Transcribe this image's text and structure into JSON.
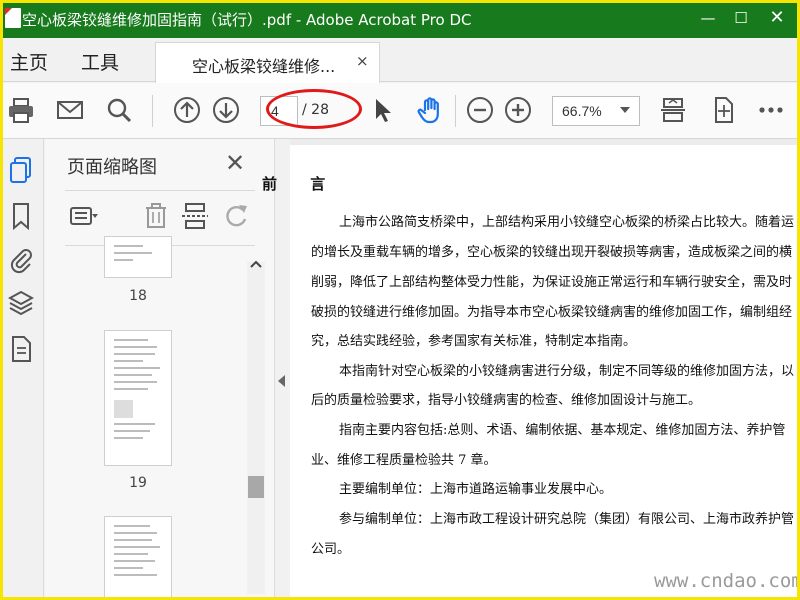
{
  "window": {
    "title": "空心板梁铰缝维修加固指南（试行）.pdf - Adobe Acrobat Pro DC",
    "minimize": "—",
    "maximize": "☐",
    "close": "✕"
  },
  "tabs": {
    "home": "主页",
    "tools": "工具",
    "document": "空心板梁铰缝维修...",
    "close": "×"
  },
  "toolbar": {
    "icons": [
      "printer-icon",
      "mail-icon",
      "search-icon",
      "page-up-icon",
      "page-down-icon",
      "select-arrow-icon",
      "hand-tool-icon",
      "zoom-out-icon",
      "zoom-in-icon",
      "fit-page-icon",
      "full-screen-icon",
      "more-icon"
    ],
    "current_page": "4",
    "total_pages": "/ 28",
    "zoom": "66.7%"
  },
  "left_rail": {
    "icons": [
      "page-thumbnails-icon",
      "bookmark-icon",
      "attachment-icon",
      "layers-icon",
      "document-icon"
    ]
  },
  "thumbnail_panel": {
    "title": "页面缩略图",
    "close": "✕",
    "tools": [
      "options-menu-icon",
      "delete-icon",
      "insert-page-icon",
      "rotate-icon"
    ],
    "pages": [
      {
        "number": "18"
      },
      {
        "number": "19"
      },
      {
        "number": ""
      }
    ]
  },
  "document": {
    "heading": "前 言",
    "lines": [
      "上海市公路简支桥梁中，上部结构采用小铰缝空心板梁的桥梁占比较大。随着运",
      "的增长及重载车辆的增多，空心板梁的铰缝出现开裂破损等病害，造成板梁之间的横",
      "削弱，降低了上部结构整体受力性能，为保证设施正常运行和车辆行驶安全，需及时",
      "破损的铰缝进行维修加固。为指导本市空心板梁铰缝病害的维修加固工作，编制组经",
      "究，总结实践经验，参考国家有关标准，特制定本指南。",
      "本指南针对空心板梁的小铰缝病害进行分级，制定不同等级的维修加固方法，以",
      "后的质量检验要求，指导小铰缝病害的检查、维修加固设计与施工。",
      "指南主要内容包括:总则、术语、编制依据、基本规定、维修加固方法、养护管",
      "业、维修工程质量检验共 7 章。",
      "主要编制单位：上海市道路运输事业发展中心。",
      "参与编制单位：上海市政工程设计研究总院（集团）有限公司、上海市政养护管",
      "公司。"
    ]
  },
  "watermark": "www.cndao.com",
  "colors": {
    "titlebar": "#177a1d",
    "frame": "#f5e500",
    "annotation_ellipse": "#e01919",
    "hand_tool": "#1a73e8",
    "rail_active": "#1a73e8"
  }
}
